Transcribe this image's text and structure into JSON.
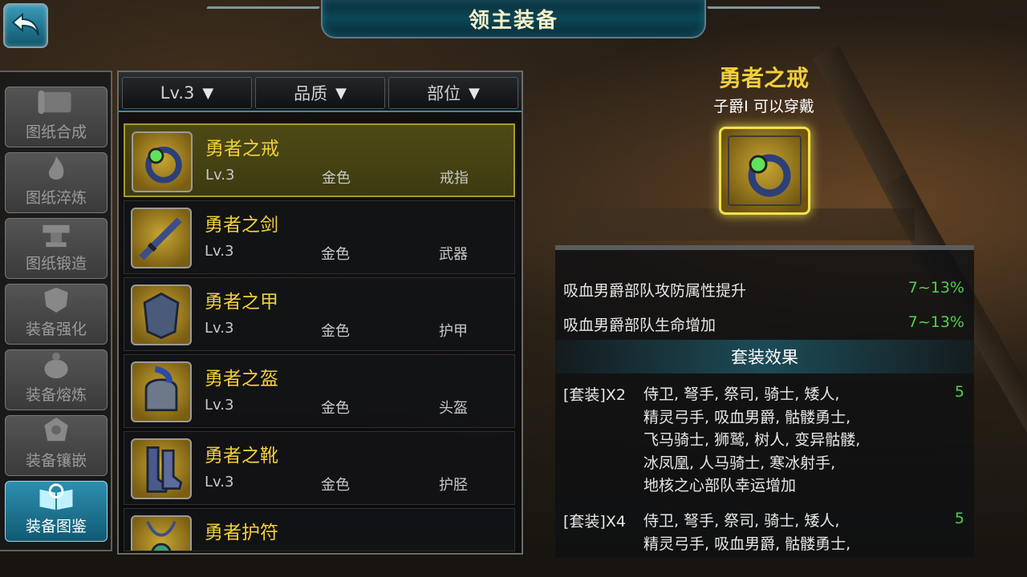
{
  "header": {
    "title": "领主装备",
    "back_icon": "back-arrow-icon"
  },
  "sidebar": {
    "items": [
      {
        "label": "图纸合成",
        "icon": "scroll-icon",
        "active": false
      },
      {
        "label": "图纸淬炼",
        "icon": "flame-icon",
        "active": false
      },
      {
        "label": "图纸锻造",
        "icon": "anvil-icon",
        "active": false
      },
      {
        "label": "装备强化",
        "icon": "armor-upgrade-icon",
        "active": false
      },
      {
        "label": "装备熔炼",
        "icon": "cauldron-icon",
        "active": false
      },
      {
        "label": "装备镶嵌",
        "icon": "gem-socket-icon",
        "active": false
      },
      {
        "label": "装备图鉴",
        "icon": "catalog-book-icon",
        "active": true
      }
    ]
  },
  "filters": {
    "level": "Lv.3",
    "quality": "品质",
    "slot": "部位",
    "arrow": "▼"
  },
  "equipment_list": [
    {
      "name": "勇者之戒",
      "level": "Lv.3",
      "quality": "金色",
      "slot": "戒指",
      "icon": "ring-icon",
      "selected": true
    },
    {
      "name": "勇者之剑",
      "level": "Lv.3",
      "quality": "金色",
      "slot": "武器",
      "icon": "sword-icon",
      "selected": false
    },
    {
      "name": "勇者之甲",
      "level": "Lv.3",
      "quality": "金色",
      "slot": "护甲",
      "icon": "armor-icon",
      "selected": false
    },
    {
      "name": "勇者之盔",
      "level": "Lv.3",
      "quality": "金色",
      "slot": "头盔",
      "icon": "helmet-icon",
      "selected": false
    },
    {
      "name": "勇者之靴",
      "level": "Lv.3",
      "quality": "金色",
      "slot": "护胫",
      "icon": "boots-icon",
      "selected": false
    },
    {
      "name": "勇者护符",
      "level": "",
      "quality": "",
      "slot": "",
      "icon": "amulet-icon",
      "selected": false
    }
  ],
  "detail": {
    "name": "勇者之戒",
    "requirement": "子爵I 可以穿戴",
    "icon": "ring-icon",
    "attributes": [
      {
        "label": "吸血男爵部队攻防属性提升",
        "value": "7~13%"
      },
      {
        "label": "吸血男爵部队生命增加",
        "value": "7~13%"
      }
    ],
    "set_title": "套装效果",
    "set_bonuses": [
      {
        "tag": "[套装]X2",
        "lines": [
          "侍卫, 弩手, 祭司, 骑士, 矮人,",
          "精灵弓手, 吸血男爵, 骷髅勇士,",
          "飞马骑士, 狮鹫, 树人, 变异骷髅,",
          "冰凤凰, 人马骑士, 寒冰射手,",
          "地核之心部队幸运增加"
        ],
        "count": "5"
      },
      {
        "tag": "[套装]X4",
        "lines": [
          "侍卫, 弩手, 祭司, 骑士, 矮人,",
          "精灵弓手, 吸血男爵, 骷髅勇士,"
        ],
        "count": "5"
      }
    ]
  },
  "colors": {
    "gold_text": "#f2cf3a",
    "green_value": "#4fd14a",
    "accent_blue": "#2d8fb0"
  }
}
